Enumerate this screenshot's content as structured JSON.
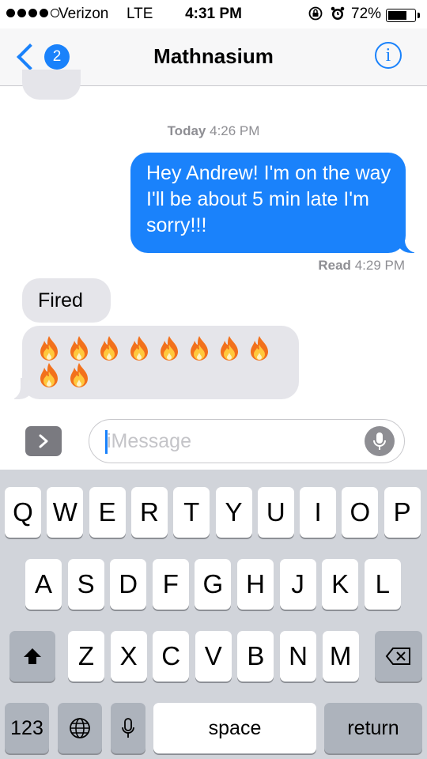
{
  "status_bar": {
    "carrier": "Verizon",
    "network": "LTE",
    "time": "4:31 PM",
    "battery_percent": "72%",
    "battery_level": 0.72,
    "signal_bars": 4,
    "icons": [
      "signal-dots-icon",
      "rotation-lock-icon",
      "alarm-icon",
      "battery-icon"
    ]
  },
  "nav": {
    "back_badge": "2",
    "title": "Mathnasium",
    "info_label": "i"
  },
  "thread": {
    "timestamp_day": "Today",
    "timestamp_time": "4:26 PM",
    "sent_message": "Hey Andrew! I'm on the way I'll be about 5 min late I'm sorry!!!",
    "read_label": "Read",
    "read_time": "4:29 PM",
    "received_messages": [
      "Fired"
    ],
    "emoji_message_count": 10,
    "emoji_name": "fire"
  },
  "composer": {
    "placeholder": "iMessage"
  },
  "keyboard": {
    "row1": [
      "Q",
      "W",
      "E",
      "R",
      "T",
      "Y",
      "U",
      "I",
      "O",
      "P"
    ],
    "row2": [
      "A",
      "S",
      "D",
      "F",
      "G",
      "H",
      "J",
      "K",
      "L"
    ],
    "row3": [
      "Z",
      "X",
      "C",
      "V",
      "B",
      "N",
      "M"
    ],
    "numbers_key": "123",
    "space_key": "space",
    "return_key": "return"
  },
  "colors": {
    "accent": "#1a82fb",
    "received_bubble": "#e5e5ea",
    "keyboard_bg": "#d1d4da"
  }
}
